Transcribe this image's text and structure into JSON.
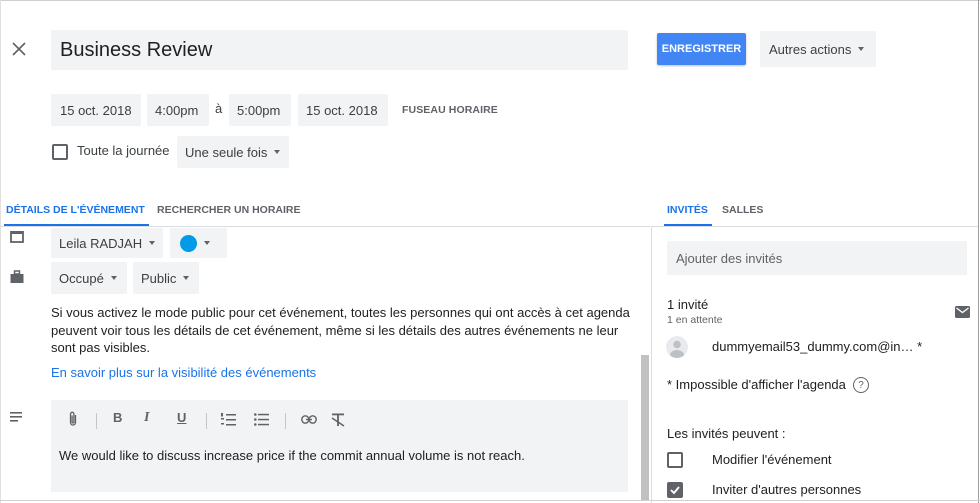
{
  "header": {
    "title": "Business Review",
    "save_label": "ENREGISTRER",
    "more_actions_label": "Autres actions"
  },
  "datetime": {
    "start_date": "15 oct. 2018",
    "start_time": "4:00pm",
    "separator": "à",
    "end_time": "5:00pm",
    "end_date": "15 oct. 2018",
    "timezone_label": "FUSEAU HORAIRE"
  },
  "options": {
    "all_day_label": "Toute la journée",
    "all_day_checked": false,
    "repeat_value": "Une seule fois"
  },
  "tabs": {
    "details": "DÉTAILS DE L'ÉVÉNEMENT",
    "find_time": "RECHERCHER UN HORAIRE",
    "guests": "INVITÉS",
    "rooms": "SALLES"
  },
  "details": {
    "calendar_owner": "Leila RADJAH",
    "event_color": "#039be5",
    "availability": "Occupé",
    "visibility": "Public",
    "visibility_info": "Si vous activez le mode public pour cet événement, toutes les personnes qui ont accès à cet agenda peuvent voir tous les détails de cet événement, même si les détails des autres événements ne leur sont pas visibles.",
    "visibility_link": "En savoir plus sur la visibilité des événements",
    "description": "We would like to discuss increase price if the commit annual volume is not reach."
  },
  "guests_panel": {
    "add_placeholder": "Ajouter des invités",
    "count_label": "1 invité",
    "pending_label": "1 en attente",
    "guest_email": "dummyemail53_dummy.com@in…  *",
    "cannot_show_note": "* Impossible d'afficher l'agenda",
    "permissions_title": "Les invités peuvent :",
    "permissions": [
      {
        "label": "Modifier l'événement",
        "checked": false
      },
      {
        "label": "Inviter d'autres personnes",
        "checked": true
      }
    ]
  },
  "colors": {
    "accent": "#1a73e8",
    "primary_button": "#4285f4",
    "field_bg": "#f1f3f4"
  }
}
